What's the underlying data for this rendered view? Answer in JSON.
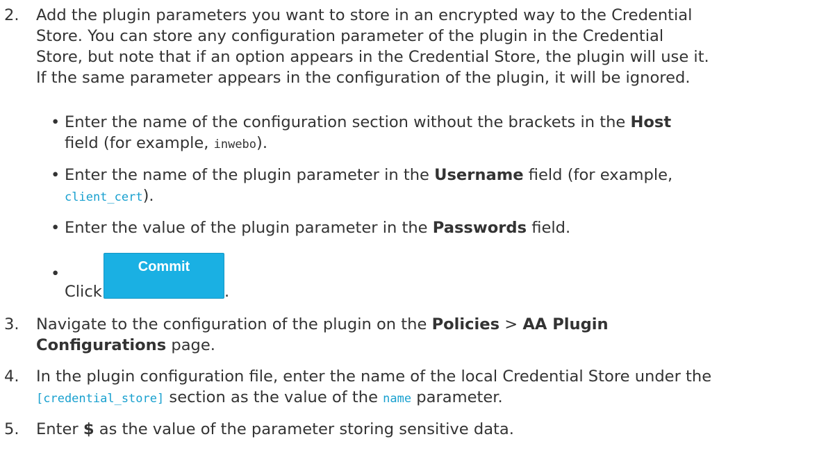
{
  "step2": {
    "number": "2.",
    "line1": "Add the plugin parameters you want to store in an encrypted way to the Credential",
    "line2": "Store. You can store any configuration parameter of the plugin in the Credential",
    "line3": "Store, but note that if an option appears in the Credential Store, the plugin will use it.",
    "line4": "If the same parameter appears in the configuration of the plugin, it will be ignored.",
    "bullets": {
      "b1": {
        "pre": "Enter the name of the configuration section without the brackets in the ",
        "bold": "Host",
        "post": " field (for example, ",
        "code": "inwebo",
        "end": ")."
      },
      "b2": {
        "pre": "Enter the name of the plugin parameter in the ",
        "bold": "Username",
        "post": " field (for example,",
        "code": "client_cert",
        "end": ")."
      },
      "b3": {
        "pre": "Enter the value of the plugin parameter in the ",
        "bold": "Passwords",
        "post": " field."
      },
      "b4": {
        "pre": "Click",
        "button_label": "Commit",
        "end": "."
      },
      "bullet_char": "•"
    }
  },
  "step3": {
    "number": "3.",
    "pre": "Navigate to the configuration of the plugin on the ",
    "bold1": "Policies",
    "sep": " > ",
    "bold2a": "AA Plugin",
    "bold2b": "Configurations",
    "post": " page."
  },
  "step4": {
    "number": "4.",
    "line1": "In the plugin configuration file, enter the name of the local Credential Store under the",
    "code1": "[credential_store]",
    "mid": " section as the value of the ",
    "code2": "name",
    "post": " parameter."
  },
  "step5": {
    "number": "5.",
    "pre": "Enter ",
    "bold": "$",
    "post": " as the value of the parameter storing sensitive data."
  },
  "colors": {
    "text": "#333333",
    "code_link": "#18a0cf",
    "button_bg": "#1ab0e3",
    "button_text": "#ffffff"
  }
}
